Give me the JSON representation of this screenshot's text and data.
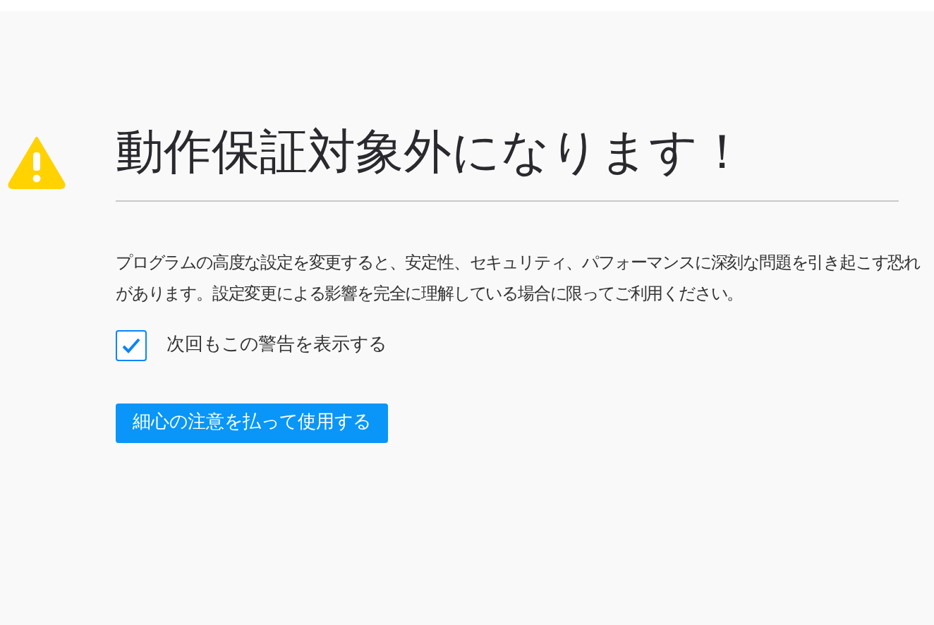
{
  "title": "動作保証対象外になります！",
  "description": "プログラムの高度な設定を変更すると、安定性、セキュリティ、パフォーマンスに深刻な問題を引き起こす恐れがあります。設定変更による影響を完全に理解している場合に限ってご利用ください。",
  "warning_checkbox": {
    "label": "次回もこの警告を表示する",
    "checked": true
  },
  "accept_button": "細心の注意を払って使用する"
}
